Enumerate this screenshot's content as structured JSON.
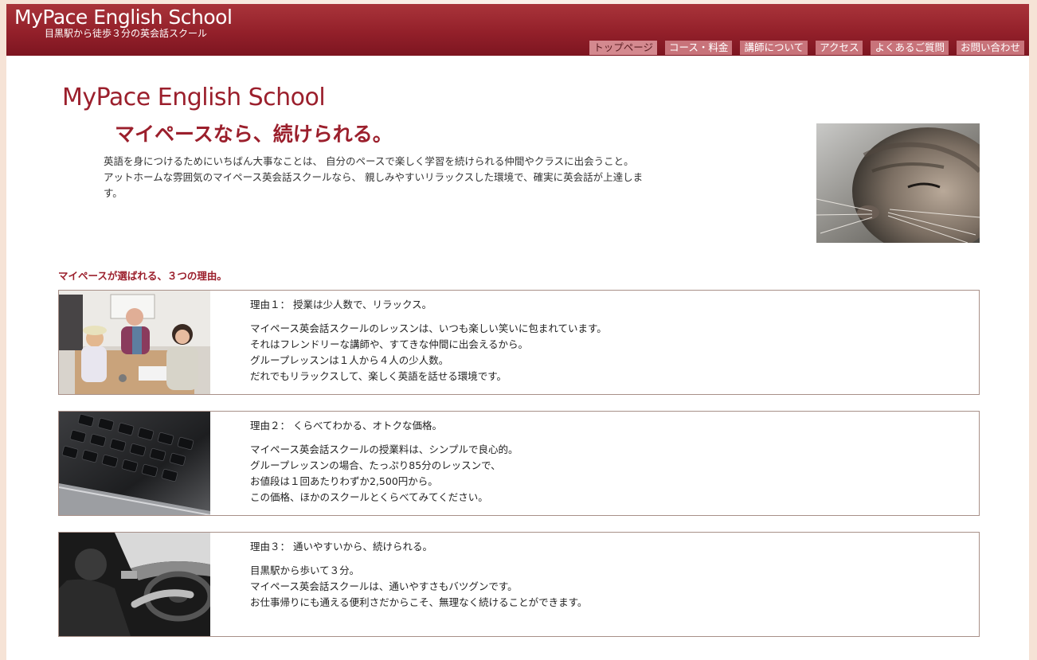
{
  "header": {
    "logo": "MyPace English School",
    "tagline": "目黒駅から徒歩３分の英会話スクール"
  },
  "nav": {
    "items": [
      {
        "label": "トップページ",
        "active": true
      },
      {
        "label": "コース・料金",
        "active": false
      },
      {
        "label": "講師について",
        "active": false
      },
      {
        "label": "アクセス",
        "active": false
      },
      {
        "label": "よくあるご質問",
        "active": false
      },
      {
        "label": "お問い合わせ",
        "active": false
      }
    ]
  },
  "main": {
    "brand": "MyPace English School",
    "headline": "マイペースなら、続けられる。",
    "intro": [
      "英語を身につけるためにいちばん大事なことは、 自分のペースで楽しく学習を続けられる仲間やクラスに出会うこと。",
      "アットホームな雰囲気のマイペース英会話スクールなら、 親しみやすいリラックスした環境で、確実に英会話が上達します。"
    ],
    "reasons_title": "マイペースが選ばれる、３つの理由。",
    "reasons": [
      {
        "title": "理由１：  授業は少人数で、リラックス。",
        "body": [
          "マイペース英会話スクールのレッスンは、いつも楽しい笑いに包まれています。",
          "それはフレンドリーな講師や、すてきな仲間に出会えるから。",
          "グループレッスンは１人から４人の少人数。",
          "だれでもリラックスして、楽しく英語を話せる環境です。"
        ]
      },
      {
        "title": "理由２：  くらべてわかる、オトクな価格。",
        "body": [
          "マイペース英会話スクールの授業料は、シンプルで良心的。",
          "グループレッスンの場合、たっぷり85分のレッスンで、",
          "お値段は１回あたりわずか2,500円から。",
          "この価格、ほかのスクールとくらべてみてください。"
        ]
      },
      {
        "title": "理由３：  通いやすいから、続けられる。",
        "body": [
          "目黒駅から歩いて３分。",
          "マイペース英会話スクールは、通いやすさもバツグンです。",
          "お仕事帰りにも通える便利さだからこそ、無理なく続けることができます。"
        ]
      }
    ]
  },
  "colors": {
    "brand_red": "#9b1f2c",
    "header_red": "#93202a",
    "nav_bg": "#c8737a",
    "box_border": "#a89088"
  }
}
